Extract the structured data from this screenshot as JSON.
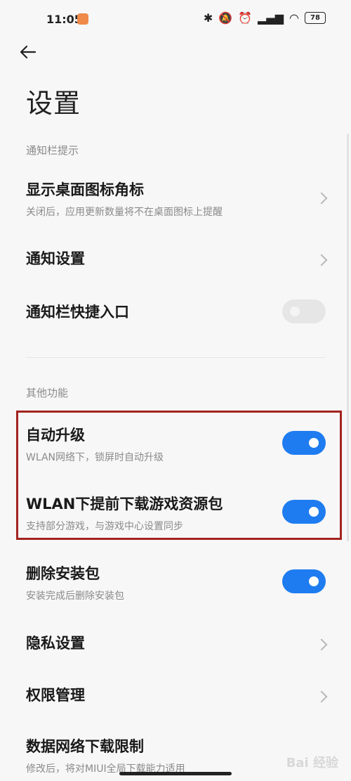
{
  "status_bar": {
    "time": "11:05",
    "battery": "78"
  },
  "page": {
    "title": "设置"
  },
  "sections": {
    "notification": "通知栏提示",
    "other": "其他功能"
  },
  "rows": {
    "show_badge": {
      "title": "显示桌面图标角标",
      "subtitle": "关闭后，应用更新数量将不在桌面图标上提醒"
    },
    "notification_settings": {
      "title": "通知设置"
    },
    "notification_shortcut": {
      "title": "通知栏快捷入口",
      "toggle": false
    },
    "auto_upgrade": {
      "title": "自动升级",
      "subtitle": "WLAN网络下，锁屏时自动升级",
      "toggle": true
    },
    "predownload": {
      "title": "WLAN下提前下载游戏资源包",
      "subtitle": "支持部分游戏，与游戏中心设置同步",
      "toggle": true
    },
    "delete_package": {
      "title": "删除安装包",
      "subtitle": "安装完成后删除安装包",
      "toggle": true
    },
    "privacy": {
      "title": "隐私设置"
    },
    "permissions": {
      "title": "权限管理"
    },
    "data_limit": {
      "title": "数据网络下载限制",
      "subtitle": "修改后，将对MIUI全局下载能力适用"
    }
  },
  "watermark": "Bai 经验",
  "colors": {
    "toggle_on": "#1e7cf0",
    "highlight_border": "#a3231e"
  }
}
